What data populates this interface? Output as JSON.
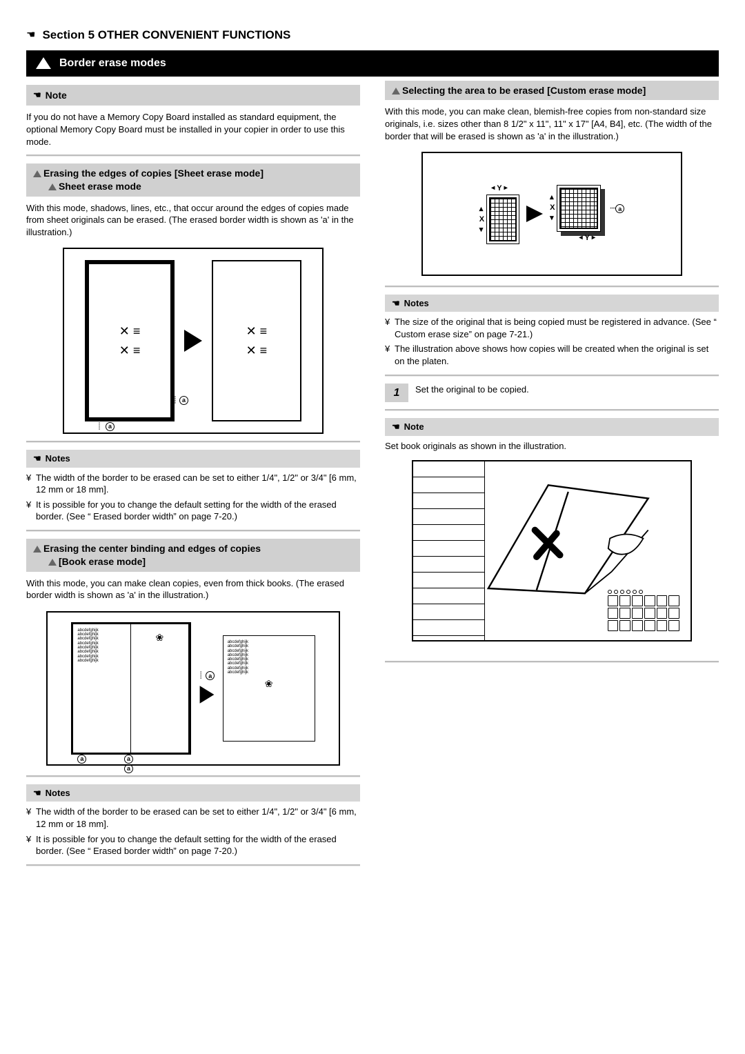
{
  "header": {
    "section_label": "Section 5  OTHER CONVENIENT FUNCTIONS",
    "bar_title": "Border erase modes"
  },
  "left": {
    "note_box_label": "Note",
    "memory_note": "If you do not have a Memory Copy Board installed as standard equipment, the optional Memory Copy Board must be installed in your copier in order to use this mode.",
    "sheet_heading_line1": "Erasing the edges of copies [Sheet erase mode]",
    "sheet_heading_line2": "Sheet erase mode",
    "sheet_para": "With this mode, shadows, lines, etc., that occur around the edges of copies made from sheet originals can be erased. (The erased border width is shown as 'a' in the illustration.)",
    "sheet_notes_label": "Notes",
    "sheet_note1": "The width of the border to be erased can be set to either 1/4\", 1/2\" or 3/4\" [6 mm, 12 mm or 18 mm].",
    "sheet_note2": "It is possible for you to change the default setting for the width of the erased border. (See “ Erased border width” on page 7-20.)",
    "book_heading_line1": "Erasing the center binding and edges of copies",
    "book_heading_line2": "[Book erase mode]",
    "book_para": "With this mode, you can make clean copies, even from thick books. (The erased border width is shown as 'a' in the illustration.)",
    "book_notes_label": "Notes",
    "book_note1": "The width of the border to be erased can be set to either 1/4\", 1/2\" or 3/4\" [6 mm, 12 mm or 18 mm].",
    "book_note2": "It is possible for you to change the default setting for the width of the erased border. (See “ Erased border width” on page 7-20.)",
    "tiny": "abcdefghijk"
  },
  "right": {
    "custom_heading": "Selecting the area to be erased [Custom erase mode]",
    "custom_para": "With this mode, you can make clean, blemish-free copies from non-standard size originals, i.e. sizes other than 8 1/2\" x 11\", 11\" x 17\" [A4, B4], etc. (The width of the border that will be erased is shown as 'a' in the illustration.)",
    "xy_X": "X",
    "xy_Y": "Y",
    "a_label": "a",
    "custom_notes_label": "Notes",
    "custom_note1": "The size of the original that is being copied must be registered in advance. (See “ Custom erase size” on page 7-21.)",
    "custom_note2": "The illustration above shows how copies will be created when the original is set on the platen.",
    "step1_num": "1",
    "step1_text": "Set the original to be copied.",
    "note_label": "Note",
    "set_book_note": "Set book originals as shown in the illustration."
  }
}
